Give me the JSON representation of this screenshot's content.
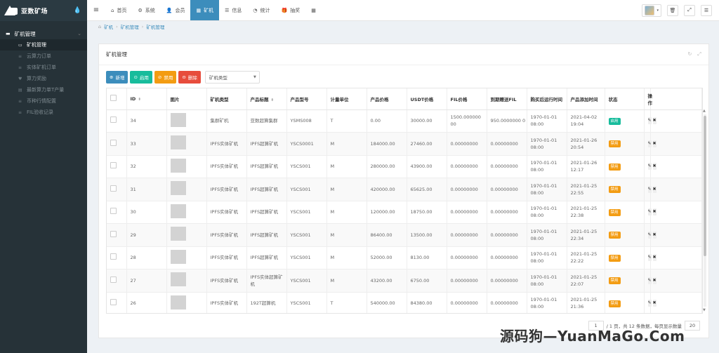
{
  "app": {
    "logo_text": "亚数矿场"
  },
  "sidebar": {
    "section": "矿机管理",
    "items": [
      {
        "label": "矿机管理",
        "active": true
      },
      {
        "label": "云算力订单",
        "active": false
      },
      {
        "label": "实体矿机订单",
        "active": false
      },
      {
        "label": "算力奖励",
        "active": false
      },
      {
        "label": "最新算力单T产量",
        "active": false
      },
      {
        "label": "币种行情配置",
        "active": false
      },
      {
        "label": "FIL验收记录",
        "active": false
      }
    ]
  },
  "topnav": [
    {
      "label": "首页",
      "icon": "home-icon"
    },
    {
      "label": "系统",
      "icon": "gear-icon"
    },
    {
      "label": "会员",
      "icon": "user-icon"
    },
    {
      "label": "矿机",
      "icon": "grid-icon",
      "active": true
    },
    {
      "label": "信息",
      "icon": "list-icon"
    },
    {
      "label": "统计",
      "icon": "chart-icon"
    },
    {
      "label": "抽奖",
      "icon": "gift-icon"
    }
  ],
  "breadcrumb": [
    "矿机",
    "矿机管理",
    "矿机管理"
  ],
  "panel": {
    "title": "矿机管理"
  },
  "toolbar": {
    "add": "新增",
    "enable": "启用",
    "disable": "禁用",
    "delete": "删除",
    "type_select": "矿机类型"
  },
  "table": {
    "headers": [
      "ID",
      "图片",
      "矿机类型",
      "产品标题",
      "产品型号",
      "计量单位",
      "产品价格",
      "USDT价格",
      "FIL价格",
      "到期赠送FIL",
      "购买后运行时间",
      "产品添加时间",
      "状态",
      "操作"
    ],
    "rows": [
      {
        "id": "34",
        "type": "集群矿机",
        "title": "亚数超算集群",
        "model": "YSMS008",
        "unit": "T",
        "price": "0.00",
        "usdt": "30000.00",
        "fil": "1500.000000 00",
        "gift": "950.0000000 0",
        "run": "1970-01-01 08:00",
        "added": "2021-04-02 19:04",
        "status": "启用",
        "status_on": true
      },
      {
        "id": "33",
        "type": "IPFS实体矿机",
        "title": "IPFS超算矿机",
        "model": "YSCS0001",
        "unit": "M",
        "price": "184000.00",
        "usdt": "27460.00",
        "fil": "0.00000000",
        "gift": "0.00000000",
        "run": "1970-01-01 08:00",
        "added": "2021-01-26 20:54",
        "status": "禁用",
        "status_on": false
      },
      {
        "id": "32",
        "type": "IPFS实体矿机",
        "title": "IPFS超算矿机",
        "model": "YSCS001",
        "unit": "M",
        "price": "280000.00",
        "usdt": "43900.00",
        "fil": "0.00000000",
        "gift": "0.00000000",
        "run": "1970-01-01 08:00",
        "added": "2021-01-26 12:17",
        "status": "禁用",
        "status_on": false
      },
      {
        "id": "31",
        "type": "IPFS实体矿机",
        "title": "IPFS超算矿机",
        "model": "YSCS001",
        "unit": "M",
        "price": "420000.00",
        "usdt": "65625.00",
        "fil": "0.00000000",
        "gift": "0.00000000",
        "run": "1970-01-01 08:00",
        "added": "2021-01-25 22:55",
        "status": "禁用",
        "status_on": false
      },
      {
        "id": "30",
        "type": "IPFS实体矿机",
        "title": "IPFS超算矿机",
        "model": "YSCS001",
        "unit": "M",
        "price": "120000.00",
        "usdt": "18750.00",
        "fil": "0.00000000",
        "gift": "0.00000000",
        "run": "1970-01-01 08:00",
        "added": "2021-01-25 22:38",
        "status": "禁用",
        "status_on": false
      },
      {
        "id": "29",
        "type": "IPFS实体矿机",
        "title": "IPFS超算矿机",
        "model": "YSCS001",
        "unit": "M",
        "price": "86400.00",
        "usdt": "13500.00",
        "fil": "0.00000000",
        "gift": "0.00000000",
        "run": "1970-01-01 08:00",
        "added": "2021-01-25 22:34",
        "status": "禁用",
        "status_on": false
      },
      {
        "id": "28",
        "type": "IPFS实体矿机",
        "title": "IPFS超算矿机",
        "model": "YSCS001",
        "unit": "M",
        "price": "52000.00",
        "usdt": "8130.00",
        "fil": "0.00000000",
        "gift": "0.00000000",
        "run": "1970-01-01 08:00",
        "added": "2021-01-25 22:22",
        "status": "禁用",
        "status_on": false
      },
      {
        "id": "27",
        "type": "IPFS实体矿机",
        "title": "IPFS实体超算矿机",
        "model": "YSCS001",
        "unit": "M",
        "price": "43200.00",
        "usdt": "6750.00",
        "fil": "0.00000000",
        "gift": "0.00000000",
        "run": "1970-01-01 08:00",
        "added": "2021-01-25 22:07",
        "status": "禁用",
        "status_on": false
      },
      {
        "id": "26",
        "type": "IPFS实体矿机",
        "title": "192T超算机",
        "model": "YSCS001",
        "unit": "T",
        "price": "540000.00",
        "usdt": "84380.00",
        "fil": "0.00000000",
        "gift": "0.00000000",
        "run": "1970-01-01 08:00",
        "added": "2021-01-25 21:36",
        "status": "禁用",
        "status_on": false
      }
    ]
  },
  "pager": {
    "page": "1",
    "text": "/ 1 页，共 12 条数据，每页显示数量",
    "size": "20"
  },
  "watermark": "源码狗—YuanMaGo.Com"
}
